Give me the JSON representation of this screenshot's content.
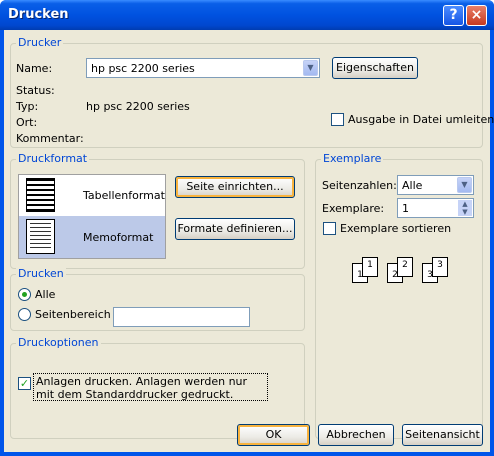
{
  "title": "Drucken",
  "titlebar": {
    "help_glyph": "?",
    "close_glyph": "×"
  },
  "drucker": {
    "label": "Drucker",
    "name_label": "Name:",
    "name_value": "hp psc 2200 series",
    "properties_button": "Eigenschaften",
    "status_label": "Status:",
    "typ_label": "Typ:",
    "typ_value": "hp psc 2200 series",
    "ort_label": "Ort:",
    "kommentar_label": "Kommentar:",
    "print_to_file": "Ausgabe in Datei umleiten"
  },
  "druckformat": {
    "label": "Druckformat",
    "items": [
      {
        "label": "Tabellenformat",
        "selected": false
      },
      {
        "label": "Memoformat",
        "selected": true
      }
    ],
    "page_setup_button": "Seite einrichten...",
    "define_styles_button": "Formate definieren..."
  },
  "exemplare": {
    "label": "Exemplare",
    "pages_label": "Seitenzahlen:",
    "pages_value": "Alle",
    "copies_label": "Exemplare:",
    "copies_value": "1",
    "collate_label": "Exemplare sortieren",
    "collate_checked": false,
    "collate_pages": [
      "1",
      "1",
      "2",
      "2",
      "3",
      "3"
    ]
  },
  "drucken": {
    "label": "Drucken",
    "all_label": "Alle",
    "range_label": "Seitenbereich",
    "range_value": ""
  },
  "druckoptionen": {
    "label": "Druckoptionen",
    "attachments_text": "Anlagen drucken. Anlagen werden nur mit dem Standarddrucker gedruckt.",
    "attachments_checked": true
  },
  "buttons": {
    "ok": "OK",
    "cancel": "Abbrechen",
    "preview": "Seitenansicht"
  },
  "colors": {
    "accent": "#0046d5",
    "titlebar": "#0052e0",
    "selection": "#bcc9e8",
    "check": "#21a121"
  }
}
